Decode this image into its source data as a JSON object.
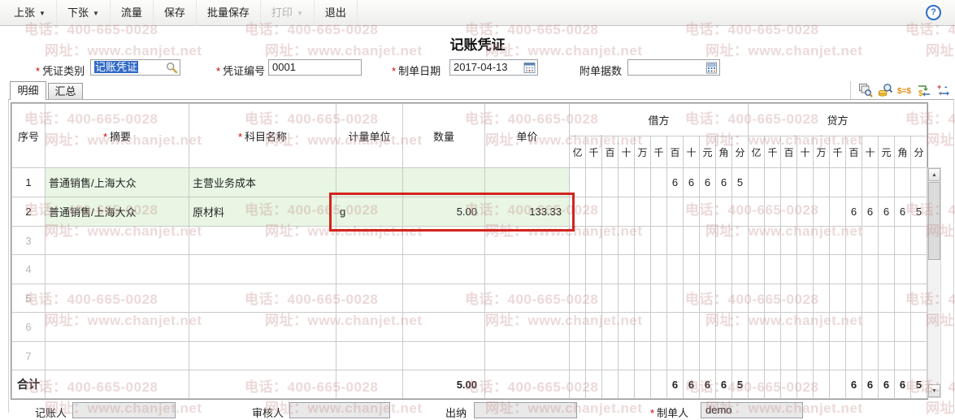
{
  "ui": {
    "required_marker": "*",
    "dropdown_arrow": "▼",
    "arrow_up": "▲",
    "arrow_down": "▼",
    "help_glyph": "?"
  },
  "colors": {
    "accent_selection": "#316ac5",
    "highlight_box": "#d2251d",
    "row_green": "#e8f6e3",
    "digit_blue_line": "#a8cce8",
    "digit_red_line": "#d8a3a3",
    "watermark": "#c68c8c"
  },
  "toolbar": {
    "items": [
      {
        "name": "prev-voucher-button",
        "label": "上张",
        "arrow": true
      },
      {
        "name": "next-voucher-button",
        "label": "下张",
        "arrow": true
      },
      {
        "name": "flow-button",
        "label": "流量"
      },
      {
        "name": "save-button",
        "label": "保存"
      },
      {
        "name": "batch-save-button",
        "label": "批量保存"
      },
      {
        "name": "print-button",
        "label": "打印",
        "arrow": true,
        "disabled": true
      },
      {
        "name": "exit-button",
        "label": "退出"
      }
    ]
  },
  "watermark": {
    "phone": "电话：400-665-0028",
    "site": "网址：www.chanjet.net"
  },
  "title": "记账凭证",
  "form": {
    "voucher_type": {
      "label": "凭证类别",
      "required": true,
      "value": "记账凭证"
    },
    "voucher_no": {
      "label": "凭证编号",
      "required": true,
      "value": "0001"
    },
    "doc_date": {
      "label": "制单日期",
      "required": true,
      "value": "2017-04-13"
    },
    "attachments": {
      "label": "附单据数",
      "required": false,
      "value": ""
    }
  },
  "tabs": [
    {
      "label": "明细",
      "active": true
    },
    {
      "label": "汇总",
      "active": false
    }
  ],
  "icon_toolbar": [
    {
      "name": "print-preview-icon"
    },
    {
      "name": "search-amount-icon"
    },
    {
      "name": "balance-amount-icon"
    },
    {
      "name": "carry-amount-icon"
    },
    {
      "name": "adjust-direction-icon"
    }
  ],
  "grid": {
    "columns": [
      {
        "label": "序号"
      },
      {
        "label": "摘要",
        "required": true
      },
      {
        "label": "科目名称",
        "required": true
      },
      {
        "label": "计量单位"
      },
      {
        "label": "数量"
      },
      {
        "label": "单价"
      }
    ],
    "debit_label": "借方",
    "credit_label": "贷方",
    "digit_labels": [
      "亿",
      "千",
      "百",
      "十",
      "万",
      "千",
      "百",
      "十",
      "元",
      "角",
      "分"
    ],
    "rows": [
      {
        "no": "1",
        "summary": "普通销售/上海大众",
        "account": "主营业务成本",
        "unit": "",
        "qty": "",
        "price": "",
        "debit_digits": "66665",
        "credit_digits": ""
      },
      {
        "no": "2",
        "summary": "普通销售/上海大众",
        "account": "原材料",
        "unit": "g",
        "qty": "5.00",
        "price": "133.33",
        "debit_digits": "",
        "credit_digits": "66665",
        "highlighted": true
      },
      {
        "no": "3"
      },
      {
        "no": "4"
      },
      {
        "no": "5"
      },
      {
        "no": "6"
      },
      {
        "no": "7"
      }
    ],
    "total": {
      "label": "合计",
      "qty": "5.00",
      "debit_digits": "66665",
      "credit_digits": "66665"
    }
  },
  "footer": {
    "fields": [
      {
        "name": "bookkeeper-field",
        "label": "记账人",
        "value": ""
      },
      {
        "name": "reviewer-field",
        "label": "审核人",
        "value": ""
      },
      {
        "name": "cashier-field",
        "label": "出纳",
        "value": ""
      },
      {
        "name": "preparer-field",
        "label": "制单人",
        "required": true,
        "value": "demo"
      }
    ]
  }
}
